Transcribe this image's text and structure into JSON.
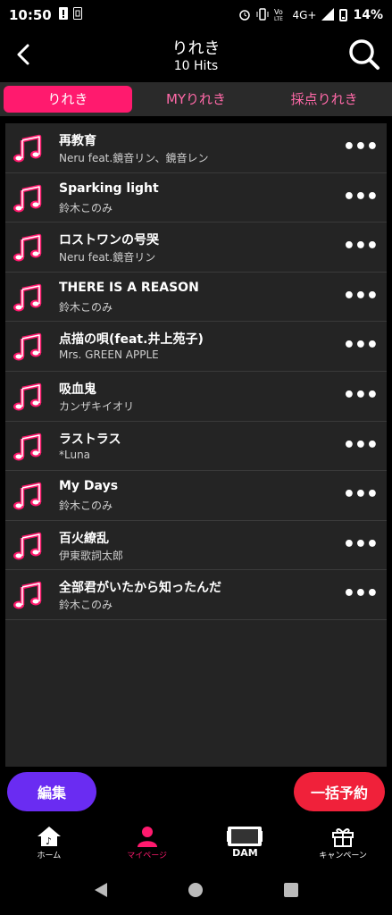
{
  "status": {
    "time": "10:50",
    "battery_percent": "14%",
    "network": "4G+"
  },
  "header": {
    "title": "りれき",
    "subtitle": "10 Hits"
  },
  "tabs": [
    {
      "label": "りれき",
      "active": true
    },
    {
      "label": "MYりれき",
      "active": false
    },
    {
      "label": "採点りれき",
      "active": false
    }
  ],
  "songs": [
    {
      "title": "再教育",
      "artist": "Neru feat.鏡音リン、鏡音レン"
    },
    {
      "title": "Sparking light",
      "artist": "鈴木このみ"
    },
    {
      "title": "ロストワンの号哭",
      "artist": "Neru feat.鏡音リン"
    },
    {
      "title": "THERE IS A REASON",
      "artist": "鈴木このみ"
    },
    {
      "title": "点描の唄(feat.井上苑子)",
      "artist": "Mrs. GREEN APPLE"
    },
    {
      "title": "吸血鬼",
      "artist": "カンザキイオリ"
    },
    {
      "title": "ラストラス",
      "artist": "*Luna"
    },
    {
      "title": "My Days",
      "artist": "鈴木このみ"
    },
    {
      "title": "百火繚乱",
      "artist": "伊東歌詞太郎"
    },
    {
      "title": "全部君がいたから知ったんだ",
      "artist": "鈴木このみ"
    }
  ],
  "actions": {
    "edit": "編集",
    "reserve": "一括予約"
  },
  "bottom_nav": [
    {
      "label": "ホーム",
      "icon": "home-icon"
    },
    {
      "label": "マイページ",
      "icon": "person-icon",
      "active": true
    },
    {
      "label": "DAM",
      "icon": "dam-logo"
    },
    {
      "label": "キャンペーン",
      "icon": "gift-icon"
    }
  ],
  "colors": {
    "accent": "#ff1a6e",
    "edit": "#6a2cf2",
    "reserve": "#f0213a"
  }
}
